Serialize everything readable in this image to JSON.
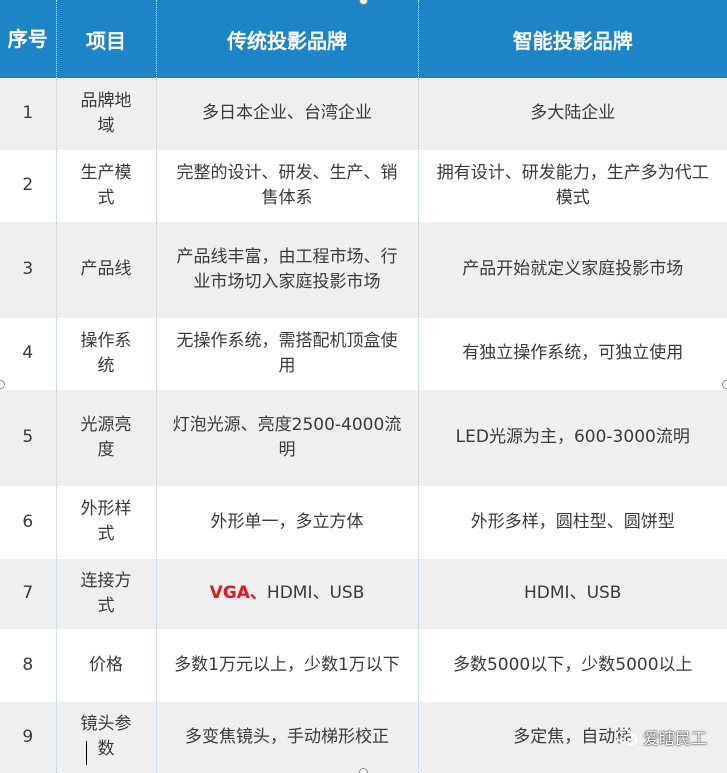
{
  "colors": {
    "header_bg": "#1e84c8",
    "header_text": "#ffffff",
    "row_alt_bg": "#efefef",
    "highlight_text": "#e8141b"
  },
  "table": {
    "headers": [
      "序号",
      "项目",
      "传统投影品牌",
      "智能投影品牌"
    ],
    "rows": [
      {
        "num": "1",
        "item": "品牌地域",
        "traditional": "多日本企业、台湾企业",
        "smart": "多大陆企业"
      },
      {
        "num": "2",
        "item": "生产模式",
        "traditional": "完整的设计、研发、生产、销售体系",
        "smart": "拥有设计、研发能力，生产多为代工模式"
      },
      {
        "num": "3",
        "item": "产品线",
        "traditional": "产品线丰富，由工程市场、行业市场切入家庭投影市场",
        "smart": "产品开始就定义家庭投影市场"
      },
      {
        "num": "4",
        "item": "操作系统",
        "traditional": "无操作系统，需搭配机顶盒使用",
        "smart": "有独立操作系统，可独立使用"
      },
      {
        "num": "5",
        "item": "光源亮度",
        "traditional": "灯泡光源、亮度2500-4000流明",
        "smart": "LED光源为主，600-3000流明"
      },
      {
        "num": "6",
        "item": "外形样式",
        "traditional": "外形单一，多立方体",
        "smart": "外形多样，圆柱型、圆饼型"
      },
      {
        "num": "7",
        "item": "连接方式",
        "traditional_highlight": "VGA、",
        "traditional_rest": "HDMI、USB",
        "smart": "HDMI、USB"
      },
      {
        "num": "8",
        "item": "价格",
        "traditional": "多数1万元以上，少数1万以下",
        "smart": "多数5000以下，少数5000以上"
      },
      {
        "num": "9",
        "item": "镜头参数",
        "traditional": "多变焦镜头，手动梯形校正",
        "smart": "多定焦，自动梯"
      }
    ]
  },
  "watermark": {
    "text": "爱瞎民工",
    "icon": "wechat-icon"
  }
}
